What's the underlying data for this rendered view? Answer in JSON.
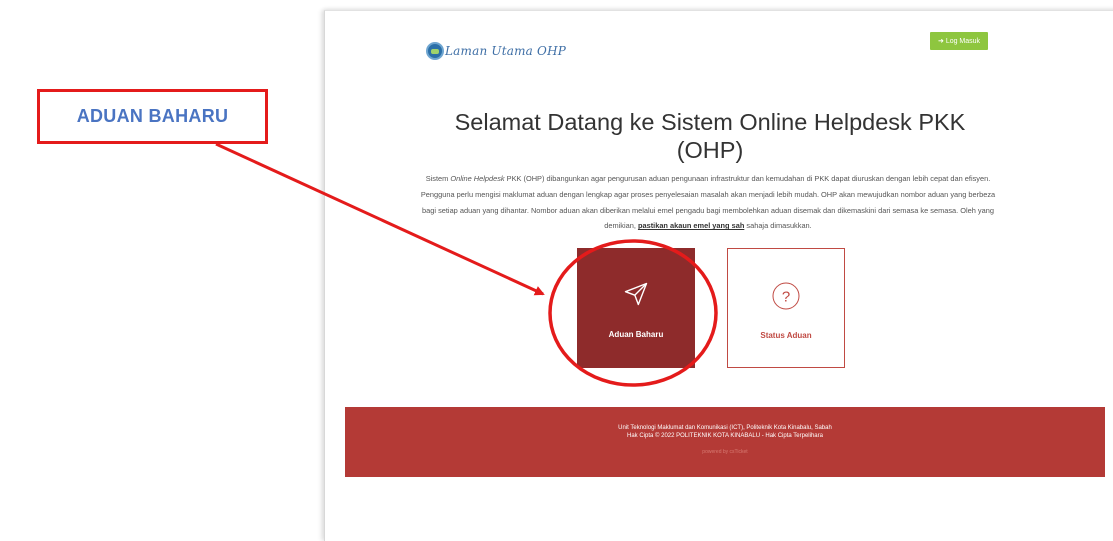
{
  "header": {
    "logo_text": "Laman Utama OHP",
    "login_label": "Log Masuk"
  },
  "hero": {
    "title_line1": "Selamat Datang ke Sistem Online Helpdesk PKK",
    "title_line2": "(OHP)"
  },
  "intro": {
    "p1_prefix": "Sistem ",
    "p1_em": "Online Helpdesk",
    "p1_rest": " PKK (OHP) dibangunkan agar pengurusan aduan pengunaan infrastruktur dan kemudahan di PKK dapat diuruskan dengan lebih cepat dan efisyen. Pengguna perlu mengisi maklumat aduan dengan lengkap agar proses penyelesaian masalah akan menjadi lebih mudah. OHP akan mewujudkan nombor aduan yang berbeza bagi setiap aduan yang dihantar. Nombor aduan akan diberikan melalui emel pengadu bagi membolehkan aduan disemak dan dikemaskini dari semasa ke semasa. Oleh yang demikian, ",
    "p1_link": "pastikan akaun emel yang sah",
    "p1_suffix": " sahaja dimasukkan."
  },
  "cards": {
    "new_complaint": "Aduan Baharu",
    "status": "Status Aduan"
  },
  "footer": {
    "line1": "Unit Teknologi Maklumat dan Komunikasi (ICT), Politeknik Kota Kinabalu, Sabah",
    "line2": "Hak Cipta © 2022 POLITEKNIK KOTA KINABALU - Hak Cipta Terpelihara",
    "line3": "powered by csTicket"
  },
  "annotation": {
    "callout_label": "ADUAN BAHARU",
    "color": "#e41b1b"
  },
  "colors": {
    "primary_card": "#8e2b2b",
    "footer": "#b43a36",
    "login_button": "#8ec63f",
    "callout_text": "#4a74c2"
  }
}
